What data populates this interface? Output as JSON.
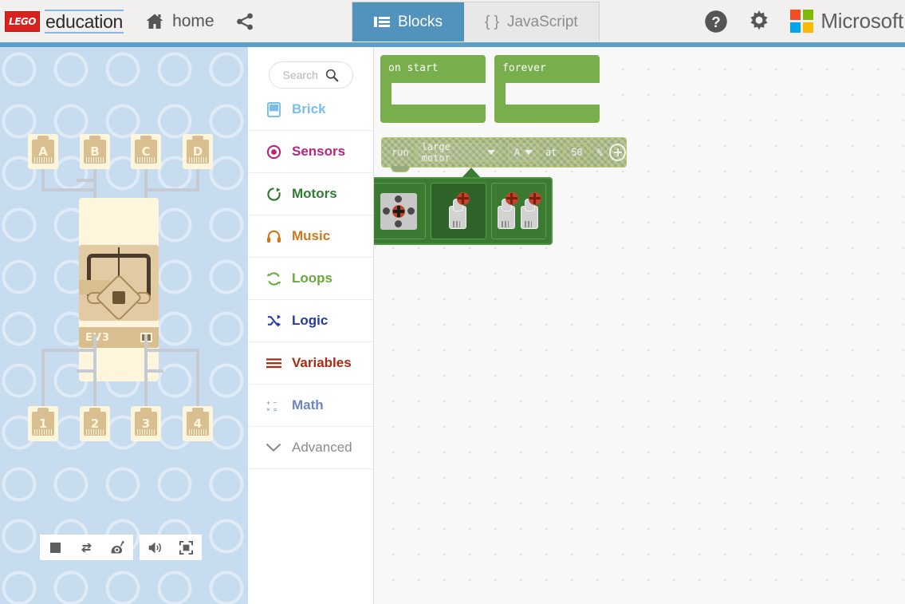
{
  "header": {
    "brand_logo_text": "LEGO",
    "brand_name": "education",
    "home_label": "home",
    "home_icon": "home-icon",
    "share_icon": "share-icon",
    "help_icon": "question-mark-icon",
    "settings_icon": "gear-icon",
    "microsoft_label": "Microsoft",
    "accent_color": "#5A9FC9",
    "tabs": [
      {
        "label": "Blocks",
        "icon": "blocks-icon",
        "active": true
      },
      {
        "label": "JavaScript",
        "icon": "braces-icon",
        "active": false
      }
    ]
  },
  "simulator": {
    "brick_label": "EV3",
    "motor_ports": [
      "A",
      "B",
      "C",
      "D"
    ],
    "sensor_ports": [
      "1",
      "2",
      "3",
      "4"
    ],
    "background_color": "#C8DCF0",
    "toolbar": [
      {
        "name": "stop-button",
        "icon": "stop-square-icon"
      },
      {
        "name": "restart-button",
        "icon": "restart-arrows-icon"
      },
      {
        "name": "slow-motion-button",
        "icon": "snail-icon"
      },
      {
        "name": "mute-button",
        "icon": "speaker-icon"
      },
      {
        "name": "fullscreen-button",
        "icon": "fullscreen-icon"
      }
    ]
  },
  "toolbox": {
    "search_placeholder": "Search",
    "search_value": "",
    "search_icon": "magnifier-icon",
    "categories": [
      {
        "label": "Brick",
        "icon": "brick-screen-icon",
        "color": "#7BBDE8"
      },
      {
        "label": "Sensors",
        "icon": "sensor-target-icon",
        "color": "#B7247E"
      },
      {
        "label": "Motors",
        "icon": "motor-rotate-icon",
        "color": "#2E7D32"
      },
      {
        "label": "Music",
        "icon": "headphones-icon",
        "color": "#D2761B"
      },
      {
        "label": "Loops",
        "icon": "loop-arrows-icon",
        "color": "#69A83C"
      },
      {
        "label": "Logic",
        "icon": "shuffle-arrows-icon",
        "color": "#253A9B"
      },
      {
        "label": "Variables",
        "icon": "lines-icon",
        "color": "#A82B12"
      },
      {
        "label": "Math",
        "icon": "operators-icon",
        "color": "#6E86C6"
      },
      {
        "label": "Advanced",
        "icon": "chevron-down-icon",
        "color": "#8C8C8C"
      }
    ]
  },
  "workspace": {
    "background_color": "#F8F8F8",
    "blocks": [
      {
        "name": "on-start-block",
        "label": "on start",
        "color": "#78AE4B"
      },
      {
        "name": "forever-block",
        "label": "forever",
        "color": "#78AE4B"
      }
    ],
    "run_block": {
      "run_label": "run",
      "motor_type": "large motor",
      "port": "A",
      "at_label": "at",
      "speed": "50",
      "percent_label": "%",
      "expand_icon": "plus-circle-icon",
      "dragging": true
    },
    "motor_picker": {
      "options": [
        {
          "name": "medium-motor-option",
          "icon": "medium-motor-icon",
          "selected": false
        },
        {
          "name": "large-motor-option",
          "icon": "large-motor-icon",
          "selected": true
        },
        {
          "name": "dual-large-motor-option",
          "icon": "dual-large-motor-icon",
          "selected": false
        }
      ]
    }
  }
}
